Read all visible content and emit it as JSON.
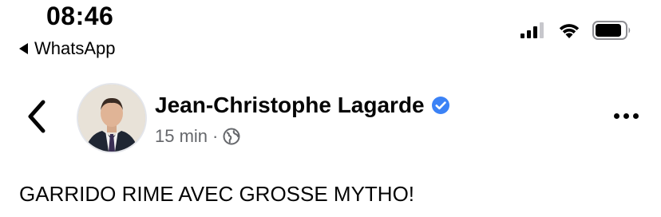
{
  "status_bar": {
    "time": "08:46",
    "back_app_label": "WhatsApp",
    "signal_icon": "cellular-signal-icon",
    "wifi_icon": "wifi-icon",
    "battery_icon": "battery-icon"
  },
  "header": {
    "back_icon": "chevron-left-icon",
    "author_name": "Jean-Christophe Lagarde",
    "verified_icon": "verified-badge-icon",
    "verified_color": "#3b82f6",
    "timestamp": "15 min",
    "separator": "·",
    "audience_icon": "globe-icon",
    "more_icon": "more-horizontal-icon"
  },
  "post": {
    "text": "GARRIDO RIME AVEC GROSSE MYTHO!"
  }
}
